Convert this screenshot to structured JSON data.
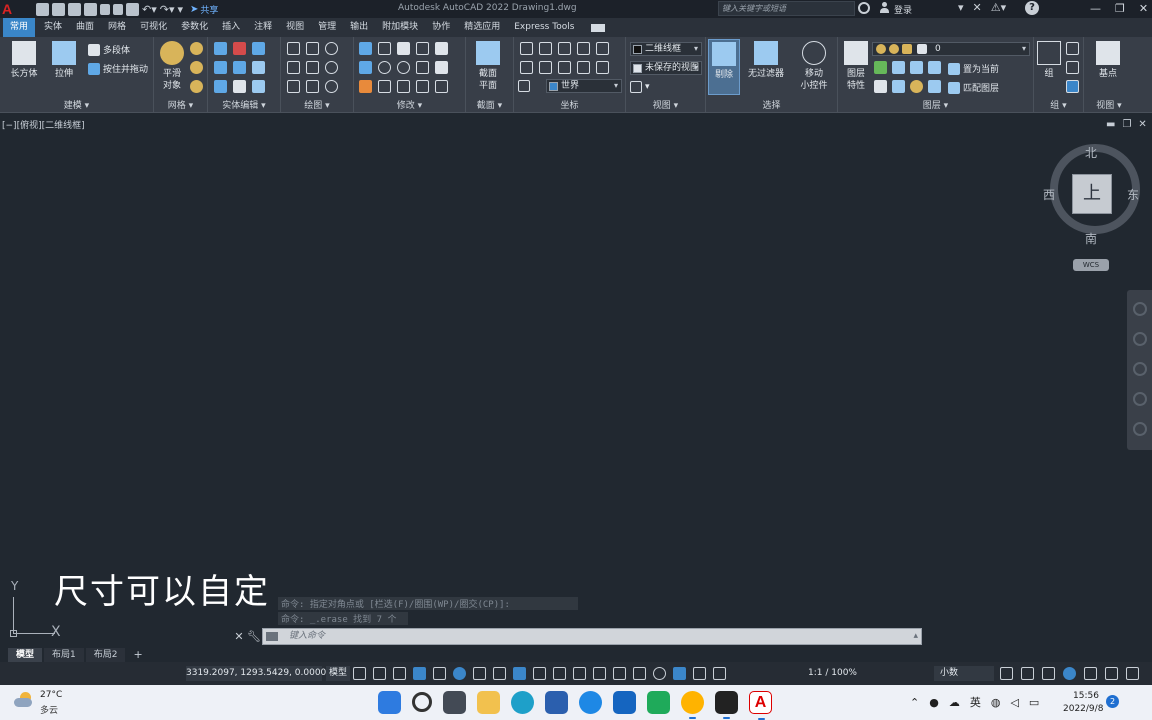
{
  "titlebar": {
    "app_title": "Autodesk AutoCAD 2022    Drawing1.dwg",
    "share_label": "共享",
    "search_placeholder": "键入关键字或短语",
    "login_label": "登录"
  },
  "ribbon_tabs": [
    "常用",
    "实体",
    "曲面",
    "网格",
    "可视化",
    "参数化",
    "插入",
    "注释",
    "视图",
    "管理",
    "输出",
    "附加模块",
    "协作",
    "精选应用",
    "Express Tools"
  ],
  "ribbon": {
    "modeling": {
      "label": "建模 ▾",
      "box": "长方体",
      "extrude": "拉伸",
      "polysolid": "多段体",
      "presspull": "按住并拖动"
    },
    "mesh": {
      "label": "网格 ▾",
      "smooth_line1": "平滑",
      "smooth_line2": "对象"
    },
    "solid_edit": {
      "label": "实体编辑 ▾"
    },
    "draw": {
      "label": "绘图 ▾"
    },
    "modify": {
      "label": "修改 ▾"
    },
    "section": {
      "label": "截面 ▾",
      "plane_line1": "截面",
      "plane_line2": "平面"
    },
    "coordinates": {
      "label": "坐标",
      "ucs_combo": "世界"
    },
    "view": {
      "label": "视图 ▾",
      "visual_style": "二维线框",
      "saved_view": "未保存的视图"
    },
    "selection": {
      "label": "选择",
      "culling": "剔除",
      "no_filter": "无过滤器",
      "gizmo_line1": "移动",
      "gizmo_line2": "小控件"
    },
    "layers": {
      "label": "图层 ▾",
      "props_line1": "图层",
      "props_line2": "特性",
      "layer_combo": "0",
      "set_current": "置为当前",
      "match_layer": "匹配图层"
    },
    "groups": {
      "label": "组 ▾",
      "group": "组"
    },
    "view2": {
      "label": "视图 ▾",
      "basepoint": "基点"
    }
  },
  "viewport": {
    "label": "[−][俯视][二维线框]",
    "compass": {
      "north": "北",
      "south": "南",
      "east": "东",
      "west": "西",
      "face": "上"
    },
    "wcs": "WCS",
    "ucs_x": "X",
    "ucs_y": "Y",
    "caption": "尺寸可以自定"
  },
  "command": {
    "history": [
      "命令: 指定对角点或 [栏选(F)/圈围(WP)/圈交(CP)]:",
      "命令: _.erase 找到 7 个"
    ],
    "placeholder": "键入命令"
  },
  "layout_tabs": [
    "模型",
    "布局1",
    "布局2"
  ],
  "statusbar": {
    "coords": "3319.2097, 1293.5429, 0.0000",
    "model": "模型",
    "scale": "1:1 / 100%",
    "units": "小数"
  },
  "taskbar": {
    "temperature": "27°C",
    "weather": "多云",
    "ime": "英",
    "time": "15:56",
    "date": "2022/9/8",
    "notifications": "2"
  },
  "colors": {
    "accent": "#3a86c8",
    "canvas": "#212830",
    "ribbon": "#383e48"
  }
}
